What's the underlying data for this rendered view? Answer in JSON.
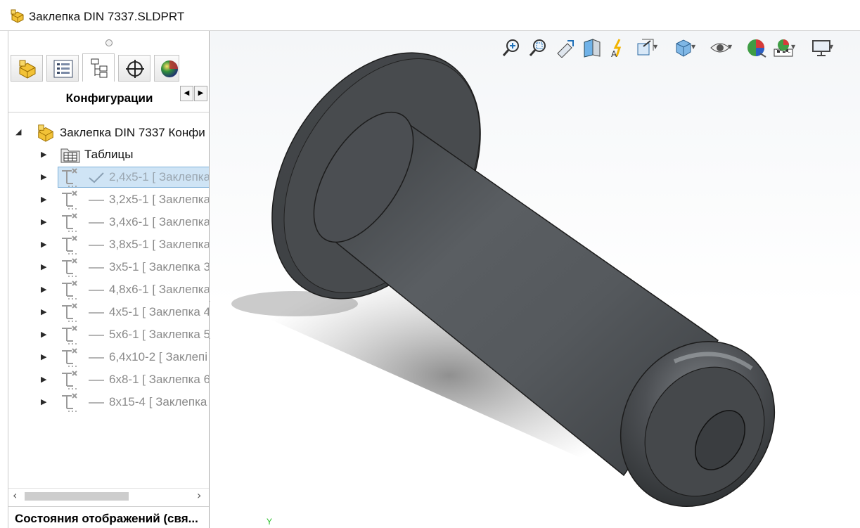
{
  "window": {
    "title": "Заклепка DIN 7337.SLDPRT",
    "title_icon": "part-icon"
  },
  "panel": {
    "tabs": [
      {
        "name": "feature-manager-tab",
        "icon": "part-icon"
      },
      {
        "name": "property-manager-tab",
        "icon": "property-list-icon"
      },
      {
        "name": "configuration-manager-tab",
        "icon": "configuration-tree-icon",
        "active": true
      },
      {
        "name": "dimxpert-tab",
        "icon": "crosshair-icon"
      },
      {
        "name": "display-manager-tab",
        "icon": "appearance-sphere-icon"
      }
    ],
    "section_title": "Конфигурации",
    "tree": {
      "root_label": "Заклепка DIN 7337 Конфи",
      "tables_label": "Таблицы",
      "configs": [
        {
          "label": "2,4x5-1 [ Заклепка",
          "active": true
        },
        {
          "label": "3,2x5-1 [ Заклепка",
          "active": false
        },
        {
          "label": "3,4x6-1 [ Заклепка",
          "active": false
        },
        {
          "label": "3,8x5-1 [ Заклепка",
          "active": false
        },
        {
          "label": "3x5-1 [ Заклепка 3",
          "active": false
        },
        {
          "label": "4,8x6-1 [ Заклепка",
          "active": false
        },
        {
          "label": "4x5-1 [ Заклепка 4",
          "active": false
        },
        {
          "label": "5x6-1 [ Заклепка 5",
          "active": false
        },
        {
          "label": "6,4x10-2 [ Заклепі",
          "active": false
        },
        {
          "label": "6x8-1 [ Заклепка 6",
          "active": false
        },
        {
          "label": "8x15-4 [ Заклепка",
          "active": false
        }
      ]
    },
    "bottom_label": "Состояния отображений (свя..."
  },
  "viewport": {
    "axis_label": "Y",
    "model_color": "#4a4d50",
    "toolbar": [
      "zoom-to-fit-icon",
      "zoom-to-area-icon",
      "previous-view-icon",
      "section-view-icon",
      "dynamic-annotation-icon",
      "view-orientation-icon",
      "display-style-icon",
      "hide-show-items-icon",
      "edit-appearance-icon",
      "apply-scene-icon",
      "view-settings-icon"
    ]
  }
}
